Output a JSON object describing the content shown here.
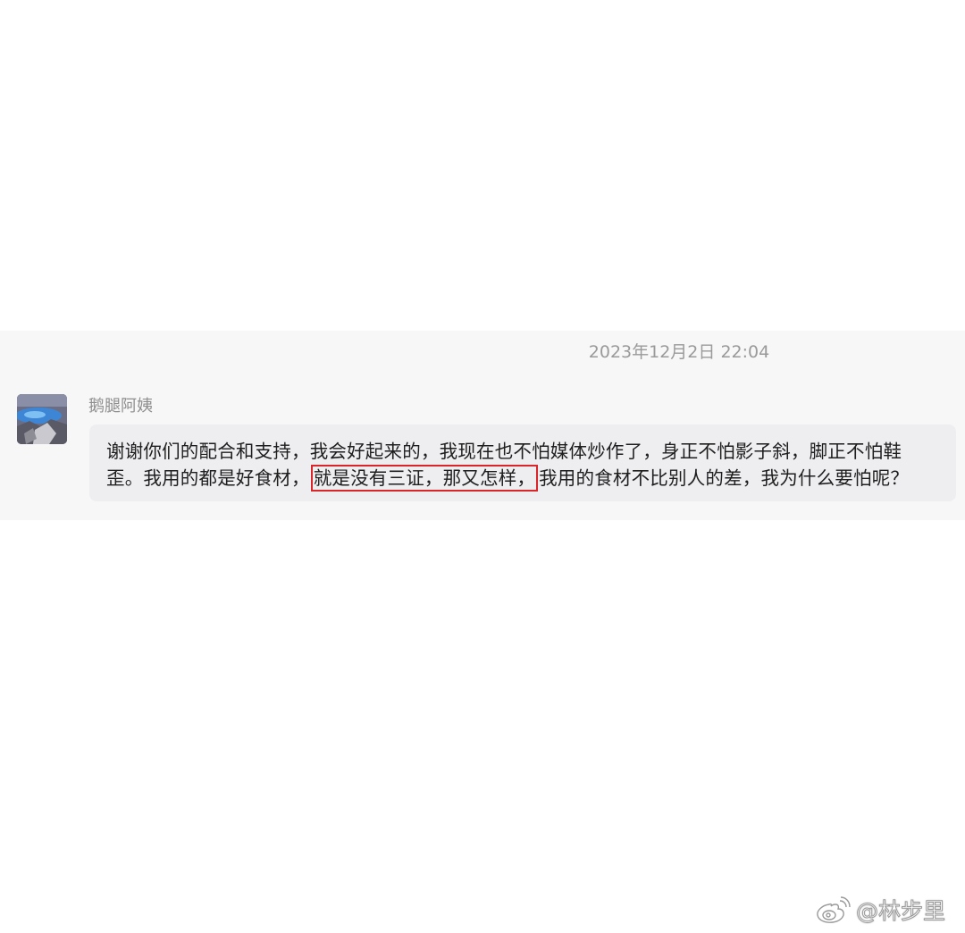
{
  "chat": {
    "timestamp": "2023年12月2日 22:04",
    "sender_name": "鹅腿阿姨",
    "message": {
      "line1": "谢谢你们的配合和支持，我会好起来的，我现在也不怕媒体炒作了，身正不怕影子斜，脚正不怕鞋",
      "line2_before": "歪。我用的都是好食材，",
      "line2_highlight": "就是没有三证，那又怎样，",
      "line2_after": "我用的食材不比别人的差，我为什么要怕呢？"
    },
    "highlight_color": "#d9262b"
  },
  "watermark": {
    "icon": "weibo-logo-icon",
    "text": "@林步里"
  }
}
